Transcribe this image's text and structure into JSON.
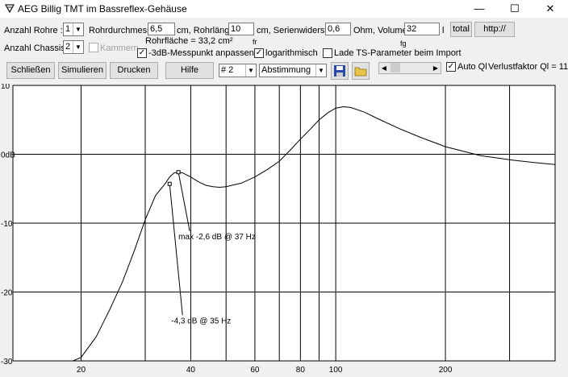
{
  "window": {
    "title": "AEG Billig TMT im Bassreflex-Gehäuse",
    "minimize": "—",
    "maximize": "☐",
    "close": "✕"
  },
  "row1": {
    "anzahl_rohre_label": "Anzahl Rohre :",
    "anzahl_rohre_value": "1",
    "rohrdurchmesser_label": "Rohrdurchmesser",
    "rohrdurchmesser_value": "6,5",
    "rohrlaenge_label": "cm, Rohrlänge",
    "rohrlaenge_value": "10",
    "serienwiderstand_label": "cm, Serienwiderstand",
    "serienwiderstand_value": "0,6",
    "volumen_label": "Ohm, Volumen",
    "volumen_value": "32",
    "volumen_unit": "l",
    "total_button": "total",
    "http_button": "http://"
  },
  "row2": {
    "anzahl_chassis_label": "Anzahl Chassis :",
    "anzahl_chassis_value": "2",
    "kammern_label": "Kammern",
    "rohrflaeche_label": "Rohrfläche = 33,2 cm²",
    "fr_label": "fr",
    "fg_label": "fg",
    "messpunkt_label": "-3dB-Messpunkt anpassen",
    "log_label": "logarithmisch",
    "lade_label": "Lade TS-Parameter beim Import"
  },
  "row3": {
    "schliessen": "Schließen",
    "simulieren": "Simulieren",
    "drucken": "Drucken",
    "hilfe": "Hilfe",
    "nr_value": "# 2",
    "abstimmung_value": "Abstimmung",
    "auto_ql_label": "Auto Ql",
    "verlustfaktor_label": "Verlustfaktor Ql = 11"
  },
  "chart_data": {
    "type": "line",
    "x_scale": "log",
    "xlim": [
      13,
      400
    ],
    "ylim": [
      -30,
      10
    ],
    "y_ticks": [
      10,
      0,
      -10,
      -20,
      -30
    ],
    "y_tick_labels": [
      "10",
      "0dB",
      "-10",
      "-20",
      "-30"
    ],
    "x_gridlines": [
      20,
      30,
      40,
      50,
      60,
      70,
      80,
      90,
      100,
      200,
      300
    ],
    "x_tick_labels": [
      {
        "x": 20,
        "label": "20"
      },
      {
        "x": 40,
        "label": "40"
      },
      {
        "x": 60,
        "label": "60"
      },
      {
        "x": 80,
        "label": "80"
      },
      {
        "x": 100,
        "label": "100"
      },
      {
        "x": 200,
        "label": "200"
      }
    ],
    "grid": true,
    "series": [
      {
        "x": [
          19,
          20,
          22,
          24,
          26,
          28,
          30,
          32,
          34,
          35,
          36,
          37,
          38,
          40,
          42,
          44,
          46,
          48,
          50,
          55,
          60,
          65,
          70,
          75,
          80,
          85,
          90,
          95,
          100,
          105,
          110,
          120,
          130,
          150,
          170,
          200,
          250,
          300,
          350,
          400
        ],
        "y": [
          -30.5,
          -29.5,
          -26.5,
          -22.5,
          -18.5,
          -14,
          -9.5,
          -6,
          -4.3,
          -3.3,
          -2.7,
          -2.6,
          -2.7,
          -3.3,
          -4,
          -4.5,
          -4.7,
          -4.8,
          -4.7,
          -4.2,
          -3.3,
          -2.2,
          -1,
          0.6,
          2.2,
          3.6,
          5,
          6,
          6.7,
          6.9,
          6.8,
          6.1,
          5.2,
          3.7,
          2.5,
          1.1,
          -0.2,
          -0.8,
          -1.2,
          -1.5
        ]
      }
    ],
    "annotations": [
      {
        "label": "max -2,6 dB @ 37 Hz",
        "x": 37,
        "y": -2.6
      },
      {
        "label": "-4,3 dB @  35 Hz",
        "x": 35,
        "y": -4.3
      }
    ]
  }
}
